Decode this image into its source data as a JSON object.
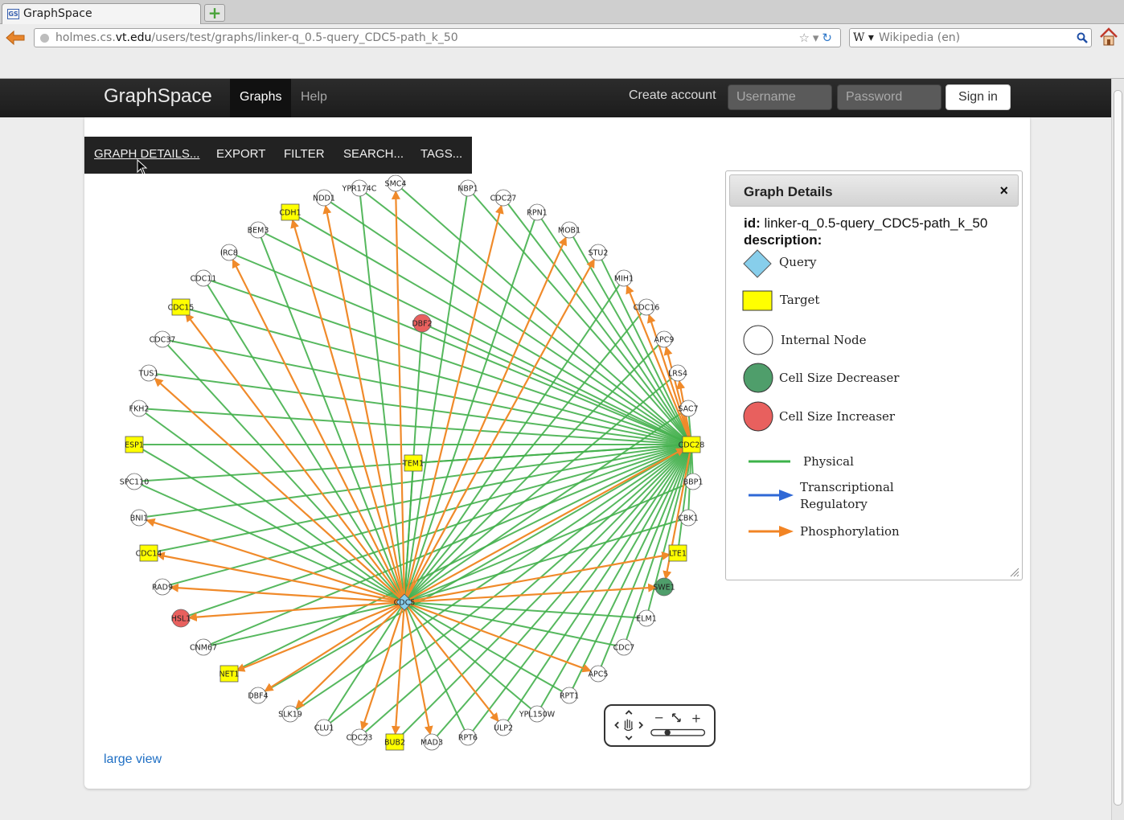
{
  "browser": {
    "tab_title": "GraphSpace",
    "favicon_text": "GS",
    "url_prefix": "holmes.cs.",
    "url_host": "vt.edu",
    "url_path": "/users/test/graphs/linker-q_0.5-query_CDC5-path_k_50",
    "search_engine_label": "W",
    "search_placeholder": "Wikipedia (en)"
  },
  "app": {
    "brand": "GraphSpace",
    "nav": [
      "Graphs",
      "Help"
    ],
    "create_account": "Create account",
    "username_placeholder": "Username",
    "password_placeholder": "Password",
    "sign_in": "Sign in"
  },
  "toolbar": {
    "items": [
      "GRAPH DETAILS...",
      "EXPORT",
      "FILTER",
      "SEARCH...",
      "TAGS..."
    ]
  },
  "large_view": "large view",
  "details": {
    "title": "Graph Details",
    "close": "×",
    "id_label": "id:",
    "id_value": "linker-q_0.5-query_CDC5-path_k_50",
    "description_label": "description:",
    "legend": [
      {
        "label": "Query",
        "shape": "diamond",
        "color": "#87ceeb"
      },
      {
        "label": "Target",
        "shape": "square",
        "color": "#ffff00"
      },
      {
        "label": "Internal Node",
        "shape": "circle",
        "color": "#ffffff"
      },
      {
        "label": "Cell Size Decreaser",
        "shape": "circle",
        "color": "#4f9e6b"
      },
      {
        "label": "Cell Size Increaser",
        "shape": "circle",
        "color": "#e8605e"
      },
      {
        "label": "Physical",
        "shape": "line",
        "color": "#3db34a"
      },
      {
        "label": "Transcriptional Regulatory",
        "shape": "arrow",
        "color": "#2f68d6"
      },
      {
        "label": "Phosphorylation",
        "shape": "arrow",
        "color": "#f28424"
      }
    ]
  },
  "graph": {
    "colors": {
      "physical": "#44b04d",
      "phosphorylation": "#f08a2a",
      "target": "#ffff00",
      "query": "#87ceeb",
      "decreaser": "#4f9e6b",
      "increaser": "#e8605e"
    },
    "hubs": [
      "CDC5",
      "CDC28"
    ],
    "nodes": [
      {
        "id": "CDC5",
        "type": "query"
      },
      {
        "id": "CDC28",
        "type": "target"
      },
      {
        "id": "TEM1",
        "type": "target"
      },
      {
        "id": "DBF2",
        "type": "increaser"
      },
      {
        "id": "YPR174C",
        "type": "internal"
      },
      {
        "id": "SMC4",
        "type": "internal"
      },
      {
        "id": "NBP1",
        "type": "internal"
      },
      {
        "id": "CDC27",
        "type": "internal"
      },
      {
        "id": "RPN1",
        "type": "internal"
      },
      {
        "id": "MOB1",
        "type": "internal"
      },
      {
        "id": "STU2",
        "type": "internal"
      },
      {
        "id": "MIH1",
        "type": "internal"
      },
      {
        "id": "CDC16",
        "type": "internal"
      },
      {
        "id": "APC9",
        "type": "internal"
      },
      {
        "id": "LRS4",
        "type": "internal"
      },
      {
        "id": "SAC7",
        "type": "internal"
      },
      {
        "id": "BBP1",
        "type": "internal"
      },
      {
        "id": "CBK1",
        "type": "internal"
      },
      {
        "id": "LTE1",
        "type": "target"
      },
      {
        "id": "SWE1",
        "type": "decreaser"
      },
      {
        "id": "ELM1",
        "type": "internal"
      },
      {
        "id": "CDC7",
        "type": "internal"
      },
      {
        "id": "APC5",
        "type": "internal"
      },
      {
        "id": "RPT1",
        "type": "internal"
      },
      {
        "id": "YPL150W",
        "type": "internal"
      },
      {
        "id": "ULP2",
        "type": "internal"
      },
      {
        "id": "RPT6",
        "type": "internal"
      },
      {
        "id": "MAD3",
        "type": "internal"
      },
      {
        "id": "BUB2",
        "type": "target"
      },
      {
        "id": "CDC23",
        "type": "internal"
      },
      {
        "id": "CLU1",
        "type": "internal"
      },
      {
        "id": "SLK19",
        "type": "internal"
      },
      {
        "id": "DBF4",
        "type": "internal"
      },
      {
        "id": "NET1",
        "type": "target"
      },
      {
        "id": "CNM67",
        "type": "internal"
      },
      {
        "id": "HSL1",
        "type": "increaser"
      },
      {
        "id": "RAD9",
        "type": "internal"
      },
      {
        "id": "CDC14",
        "type": "target"
      },
      {
        "id": "BNI1",
        "type": "internal"
      },
      {
        "id": "SPC110",
        "type": "internal"
      },
      {
        "id": "ESP1",
        "type": "target"
      },
      {
        "id": "FKH2",
        "type": "internal"
      },
      {
        "id": "TUS1",
        "type": "internal"
      },
      {
        "id": "CDC37",
        "type": "internal"
      },
      {
        "id": "CDC15",
        "type": "target"
      },
      {
        "id": "CDC11",
        "type": "internal"
      },
      {
        "id": "IRC8",
        "type": "internal"
      },
      {
        "id": "BEM3",
        "type": "internal"
      },
      {
        "id": "CDH1",
        "type": "target"
      },
      {
        "id": "NDD1",
        "type": "internal"
      }
    ],
    "phospho_from_cdc5": [
      "SMC4",
      "CDC27",
      "MOB1",
      "STU2",
      "CDC15",
      "TUS1",
      "IRC8",
      "CDH1",
      "NDD1",
      "BNI1",
      "CDC14",
      "RAD9",
      "HSL1",
      "NET1",
      "DBF4",
      "SLK19",
      "CDC23",
      "BUB2",
      "MAD3",
      "ULP2",
      "APC5",
      "SWE1",
      "LTE1",
      "CDC28"
    ],
    "phospho_from_cdc28": [
      "CDC16",
      "APC9",
      "LRS4",
      "SWE1",
      "MIH1"
    ]
  }
}
